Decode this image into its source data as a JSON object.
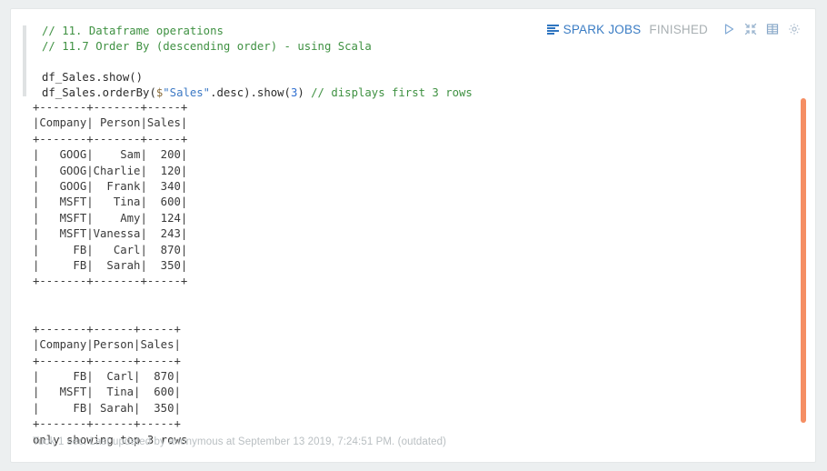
{
  "status": {
    "spark_jobs_label": "SPARK JOBS",
    "state_label": "FINISHED",
    "icons": {
      "bars": "spark-jobs-bars-icon",
      "play": "run-play-icon",
      "collapse": "collapse-icon",
      "table": "table-view-icon",
      "gear": "settings-gear-icon"
    }
  },
  "code": {
    "language": "scala",
    "lines": [
      {
        "segments": [
          {
            "text": "// 11. Dataframe operations",
            "type": "cmt"
          }
        ]
      },
      {
        "segments": [
          {
            "text": "// 11.7 Order By (descending order) - using Scala",
            "type": "cmt"
          }
        ]
      },
      {
        "segments": [
          {
            "text": "",
            "type": "plain"
          }
        ]
      },
      {
        "segments": [
          {
            "text": "df_Sales.show()",
            "type": "plain"
          }
        ]
      },
      {
        "segments": [
          {
            "text": "df_Sales.orderBy(",
            "type": "plain"
          },
          {
            "text": "$",
            "type": "sym"
          },
          {
            "text": "\"Sales\"",
            "type": "str"
          },
          {
            "text": ".desc).show(",
            "type": "plain"
          },
          {
            "text": "3",
            "type": "num"
          },
          {
            "text": ") ",
            "type": "plain"
          },
          {
            "text": "// displays first 3 rows",
            "type": "cmt"
          }
        ]
      }
    ]
  },
  "output": {
    "table1": {
      "border_top": "+-------+-------+-----+",
      "header_row": "|Company| Person|Sales|",
      "border_mid": "+-------+-------+-----+",
      "rows": [
        "|   GOOG|    Sam|  200|",
        "|   GOOG|Charlie|  120|",
        "|   GOOG|  Frank|  340|",
        "|   MSFT|   Tina|  600|",
        "|   MSFT|    Amy|  124|",
        "|   MSFT|Vanessa|  243|",
        "|     FB|   Carl|  870|",
        "|     FB|  Sarah|  350|"
      ],
      "border_bottom": "+-------+-------+-----+",
      "columns": [
        "Company",
        "Person",
        "Sales"
      ],
      "data": [
        {
          "Company": "GOOG",
          "Person": "Sam",
          "Sales": 200
        },
        {
          "Company": "GOOG",
          "Person": "Charlie",
          "Sales": 120
        },
        {
          "Company": "GOOG",
          "Person": "Frank",
          "Sales": 340
        },
        {
          "Company": "MSFT",
          "Person": "Tina",
          "Sales": 600
        },
        {
          "Company": "MSFT",
          "Person": "Amy",
          "Sales": 124
        },
        {
          "Company": "MSFT",
          "Person": "Vanessa",
          "Sales": 243
        },
        {
          "Company": "FB",
          "Person": "Carl",
          "Sales": 870
        },
        {
          "Company": "FB",
          "Person": "Sarah",
          "Sales": 350
        }
      ]
    },
    "table2": {
      "border_top": "+-------+------+-----+",
      "header_row": "|Company|Person|Sales|",
      "border_mid": "+-------+------+-----+",
      "rows": [
        "|     FB|  Carl|  870|",
        "|   MSFT|  Tina|  600|",
        "|     FB| Sarah|  350|"
      ],
      "border_bottom": "+-------+------+-----+",
      "footer_note": "only showing top 3 rows",
      "columns": [
        "Company",
        "Person",
        "Sales"
      ],
      "data": [
        {
          "Company": "FB",
          "Person": "Carl",
          "Sales": 870
        },
        {
          "Company": "MSFT",
          "Person": "Tina",
          "Sales": 600
        },
        {
          "Company": "FB",
          "Person": "Sarah",
          "Sales": 350
        }
      ]
    }
  },
  "footer": {
    "text": "Took 1 sec. Last updated by anonymous at September 13 2019, 7:24:51 PM. (outdated)"
  },
  "colors": {
    "accent_blue": "#3a7cc4",
    "comment_green": "#3f9142",
    "scrollbar_orange": "#f58e63",
    "muted_gray": "#a9b0b3",
    "card_white": "#ffffff",
    "page_gray": "#eceff0"
  }
}
